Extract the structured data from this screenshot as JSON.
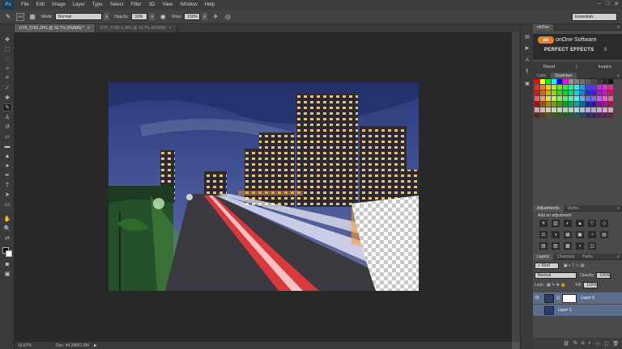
{
  "app": {
    "logo": "Ps"
  },
  "menu": [
    "File",
    "Edit",
    "Image",
    "Layer",
    "Type",
    "Select",
    "Filter",
    "3D",
    "View",
    "Window",
    "Help"
  ],
  "window_controls": [
    "–",
    "□",
    "✕"
  ],
  "options": {
    "brush_size": "250",
    "mode_label": "Mode:",
    "mode_value": "Normal",
    "opacity_label": "Opacity:",
    "opacity_value": "33%",
    "flow_label": "Flow:",
    "flow_value": "100%",
    "workspace": "Essentials"
  },
  "tabs": [
    {
      "label": "D7K_5781.JPG @ 16.7% (RGB/8) *",
      "close": "×"
    },
    {
      "label": "D7K_5780-3.JPG @ 16.7% (RGB/8)",
      "close": "×"
    }
  ],
  "status": {
    "zoom": "16.67%",
    "doc": "Doc: 44.3M/91.8M",
    "arrow": "▶"
  },
  "onone": {
    "name": "onOne Software",
    "logo": "on",
    "product": "PERFECT EFFECTS",
    "version": "8",
    "reset": "Reset",
    "separator": "|",
    "inspire": "Inspire"
  },
  "color_panel": {
    "tabs": [
      "Color",
      "Swatches"
    ],
    "active": 1
  },
  "adjustments_panel": {
    "tabs": [
      "Adjustments",
      "Styles"
    ],
    "title": "Add an adjustment",
    "icons": [
      "☀",
      "▥",
      "◐",
      "▲",
      "▽",
      "◇",
      "⚖",
      "◑",
      "▦",
      "▣",
      "◔",
      "▤",
      "▧",
      "▨",
      "▩",
      "▪",
      "◫"
    ]
  },
  "layers_panel": {
    "tabs": [
      "Layers",
      "Channels",
      "Paths"
    ],
    "kind_label": "Kind",
    "blend_mode": "Normal",
    "opacity_label": "Opacity:",
    "opacity_value": "100%",
    "lock_label": "Lock:",
    "fill_label": "Fill:",
    "fill_value": "100%",
    "layers": [
      {
        "name": "Layer 0",
        "visible": true
      },
      {
        "name": "Layer 1",
        "visible": false
      }
    ],
    "bottom_icons": [
      "⛓",
      "fx",
      "◘",
      "◐",
      "▭",
      "▢",
      "🗑"
    ]
  },
  "colors": {
    "menubar": "#3c3c3c",
    "panel": "#4a4a4a",
    "canvas": "#282828",
    "selected_layer": "#5b6e8c",
    "onone_accent": "#e67e22"
  }
}
